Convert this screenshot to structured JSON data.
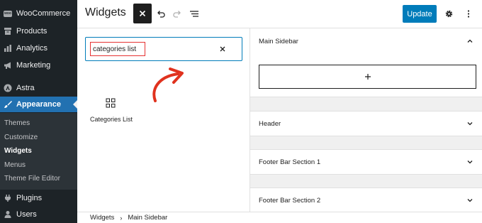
{
  "admin_menu": {
    "items": [
      {
        "label": "WooCommerce",
        "icon": "woocommerce-icon"
      },
      {
        "label": "Products",
        "icon": "archive-icon"
      },
      {
        "label": "Analytics",
        "icon": "bar-chart-icon"
      },
      {
        "label": "Marketing",
        "icon": "megaphone-icon"
      },
      {
        "label": "Astra",
        "icon": "astra-icon"
      },
      {
        "label": "Appearance",
        "icon": "paintbrush-icon",
        "active": true
      },
      {
        "label": "Plugins",
        "icon": "plug-icon"
      },
      {
        "label": "Users",
        "icon": "user-icon"
      }
    ],
    "submenu": [
      {
        "label": "Themes"
      },
      {
        "label": "Customize"
      },
      {
        "label": "Widgets",
        "current": true
      },
      {
        "label": "Menus"
      },
      {
        "label": "Theme File Editor"
      }
    ]
  },
  "header": {
    "title": "Widgets",
    "update_label": "Update"
  },
  "inserter": {
    "search_value": "categories list",
    "results": [
      {
        "label": "Categories List",
        "icon": "grid-icon"
      }
    ]
  },
  "widget_areas": [
    {
      "title": "Main Sidebar",
      "expanded": true
    },
    {
      "title": "Header",
      "expanded": false
    },
    {
      "title": "Footer Bar Section 1",
      "expanded": false
    },
    {
      "title": "Footer Bar Section 2",
      "expanded": false
    }
  ],
  "breadcrumb": [
    "Widgets",
    "Main Sidebar"
  ],
  "colors": {
    "admin_bg": "#1d2327",
    "submenu_bg": "#2c3338",
    "accent": "#2271b1",
    "update_button": "#007cba",
    "highlight": "#e63232"
  }
}
